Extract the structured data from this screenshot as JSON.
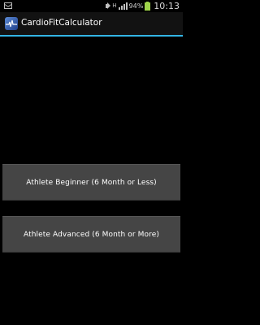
{
  "status_bar": {
    "battery_percent": "94%",
    "time": "10:13",
    "icons": [
      "gmail-icon",
      "mute-icon",
      "wifi-icon",
      "signal-icon",
      "battery-icon"
    ]
  },
  "action_bar": {
    "title": "CardioFitCalculator",
    "app_icon": "heartbeat-icon",
    "divider_color": "#33b5e5"
  },
  "buttons": {
    "beginner_label": "Athlete Beginner (6 Month or Less)",
    "advanced_label": "Athlete Advanced (6 Month or More)"
  },
  "colors": {
    "background": "#000000",
    "button": "#454545",
    "accent": "#33b5e5"
  }
}
